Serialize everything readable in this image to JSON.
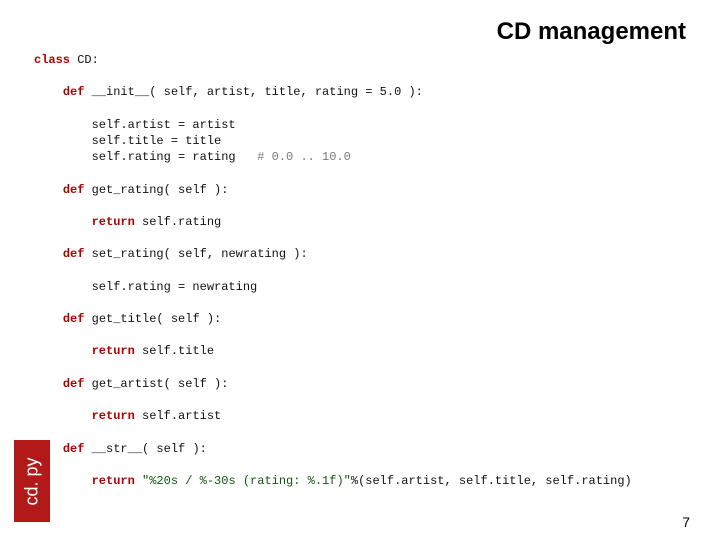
{
  "title": "CD management",
  "tab_label": "cd. py",
  "page_number": "7",
  "code": {
    "l1_kw": "class",
    "l1_rest": " CD:",
    "l2_kw": "def",
    "l2_rest": " __init__( self, artist, title, rating = 5.0 ):",
    "l3": "self.artist = artist",
    "l4": "self.title = title",
    "l5a": "self.rating = rating   ",
    "l5c": "# 0.0 .. 10.0",
    "l6_kw": "def",
    "l6_rest": " get_rating( self ):",
    "l7_kw": "return",
    "l7_rest": " self.rating",
    "l8_kw": "def",
    "l8_rest": " set_rating( self, newrating ):",
    "l9": "self.rating = newrating",
    "l10_kw": "def",
    "l10_rest": " get_title( self ):",
    "l11_kw": "return",
    "l11_rest": " self.title",
    "l12_kw": "def",
    "l12_rest": " get_artist( self ):",
    "l13_kw": "return",
    "l13_rest": " self.artist",
    "l14_kw": "def",
    "l14_rest": " __str__( self ):",
    "l15_kw": "return",
    "l15_str": " \"%20s / %-30s (rating: %.1f)\"",
    "l15_rest": "%(self.artist, self.title, self.rating)"
  }
}
